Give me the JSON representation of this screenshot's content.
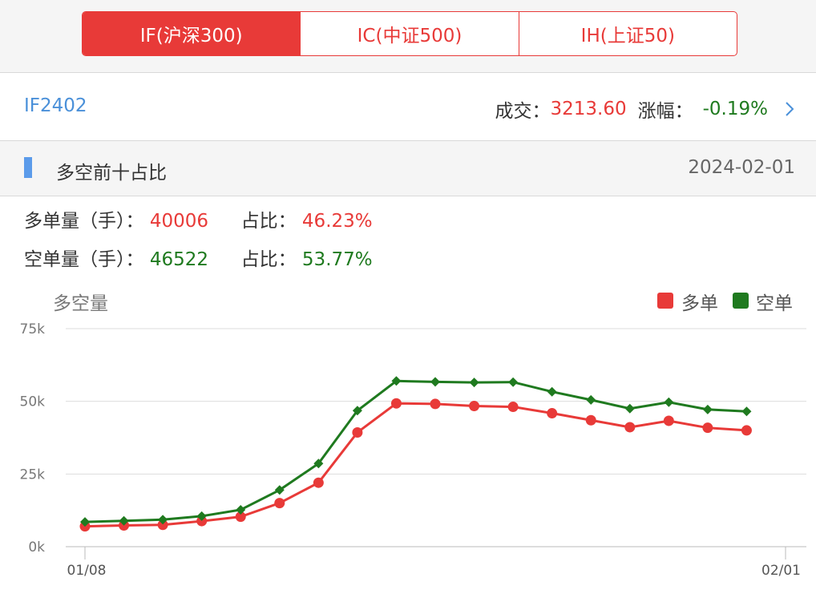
{
  "tabs": [
    {
      "label": "IF(沪深300)",
      "active": true
    },
    {
      "label": "IC(中证500)",
      "active": false
    },
    {
      "label": "IH(上证50)",
      "active": false
    }
  ],
  "contract": {
    "code": "IF2402",
    "volume_label": "成交：",
    "volume_value": "3213.60",
    "change_label": "涨幅：",
    "change_value": "-0.19%"
  },
  "section": {
    "title": "多空前十占比",
    "date": "2024-02-01"
  },
  "long": {
    "label": "多单量（手）：",
    "value": "40006",
    "ratio_label": "占比：",
    "ratio": "46.23%"
  },
  "short": {
    "label": "空单量（手）：",
    "value": "46522",
    "ratio_label": "占比：",
    "ratio": "53.77%"
  },
  "colors": {
    "long": "#e83a38",
    "short": "#1f7a1f",
    "accent": "#e83a38",
    "link": "#4a90d9"
  },
  "chart_data": {
    "type": "line",
    "title": "多空量",
    "ylim": [
      0,
      75000
    ],
    "yticks": [
      "0k",
      "25k",
      "50k",
      "75k"
    ],
    "ytick_values": [
      0,
      25000,
      50000,
      75000
    ],
    "xtick_labels": [
      "01/08",
      "02/01"
    ],
    "grid": true,
    "legend_position": "top-right",
    "x": [
      "01/08",
      "01/09",
      "01/10",
      "01/11",
      "01/12",
      "01/15",
      "01/16",
      "01/17",
      "01/18",
      "01/19",
      "01/22",
      "01/23",
      "01/24",
      "01/25",
      "01/26",
      "01/29",
      "01/30",
      "01/31",
      "02/01"
    ],
    "series": [
      {
        "name": "多单",
        "color": "#e83a38",
        "marker": "circle",
        "values": [
          7000,
          7300,
          7500,
          8800,
          10300,
          15000,
          22000,
          39300,
          49300,
          49100,
          48400,
          48100,
          45900,
          43500,
          41100,
          43300,
          40900,
          40006,
          null
        ]
      },
      {
        "name": "空单",
        "color": "#1f7a1f",
        "marker": "diamond",
        "values": [
          8500,
          8900,
          9300,
          10500,
          12700,
          19500,
          28600,
          46800,
          57000,
          56700,
          56500,
          56600,
          53300,
          50500,
          47500,
          49700,
          47200,
          46522,
          null
        ]
      }
    ]
  }
}
